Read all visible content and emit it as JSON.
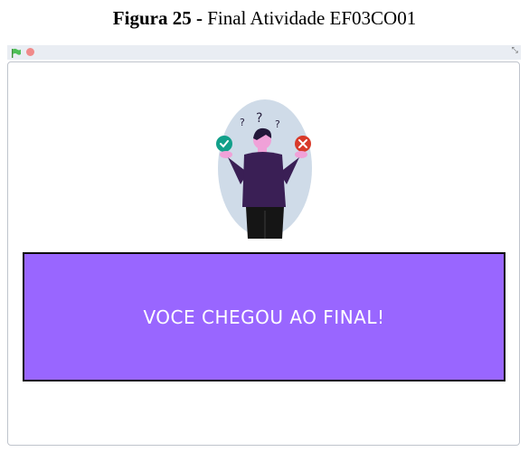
{
  "caption": {
    "label": "Figura 25 -",
    "title": "Final Atividade EF03CO01"
  },
  "toolbar": {
    "start_icon": "green-flag-icon",
    "stop_icon": "stop-icon",
    "fullscreen_icon": "fullscreen-icon"
  },
  "stage": {
    "illustration": "confused-person-check-cross-illustration",
    "banner": {
      "text": "VOCE CHEGOU AO FINAL!",
      "background": "#9966ff",
      "text_color": "#ffffff"
    }
  }
}
